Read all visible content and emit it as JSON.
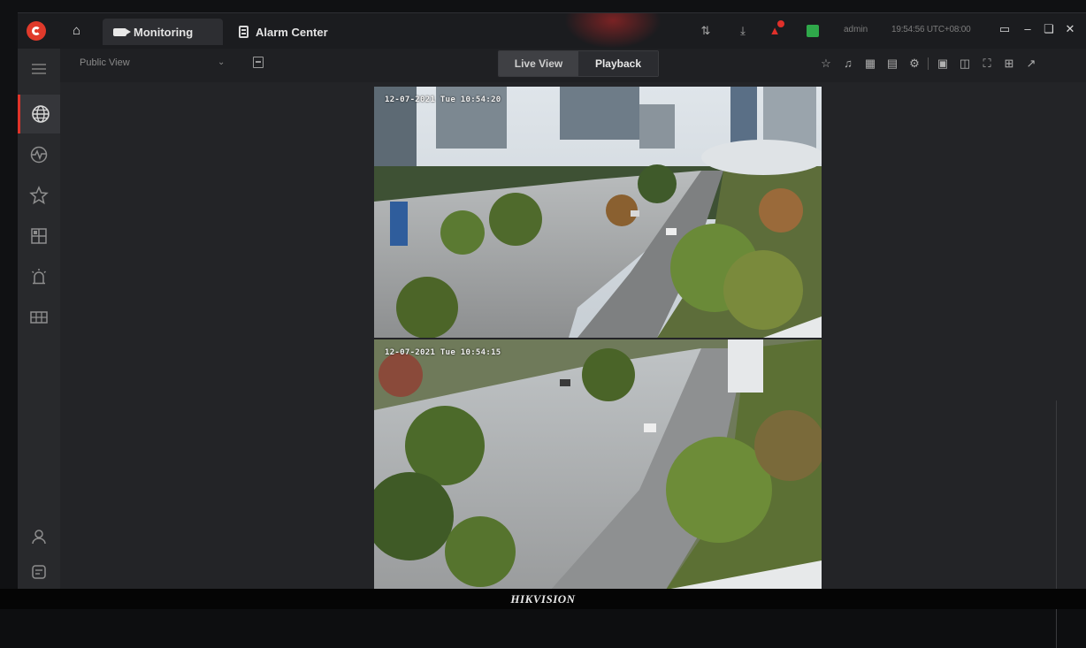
{
  "titlebar": {
    "tabs": [
      {
        "label": "Monitoring",
        "active": true,
        "icon": "camera-icon"
      },
      {
        "label": "Alarm Center",
        "active": false,
        "icon": "alarm-center-icon"
      }
    ],
    "user": "admin",
    "clock": "19:54:56 UTC+08:00"
  },
  "toolbar": {
    "view_selector": "Public View",
    "mode_tabs": [
      {
        "label": "Live View",
        "selected": true
      },
      {
        "label": "Playback",
        "selected": false
      }
    ]
  },
  "videos": [
    {
      "osd": "12-07-2021 Tue 10:54:20"
    },
    {
      "osd": "12-07-2021 Tue 10:54:15"
    }
  ],
  "footer": {
    "brand": "HIKVISION"
  },
  "colors": {
    "accent": "#e0342a",
    "panel": "#1f2023",
    "sidebar": "#28292c"
  }
}
